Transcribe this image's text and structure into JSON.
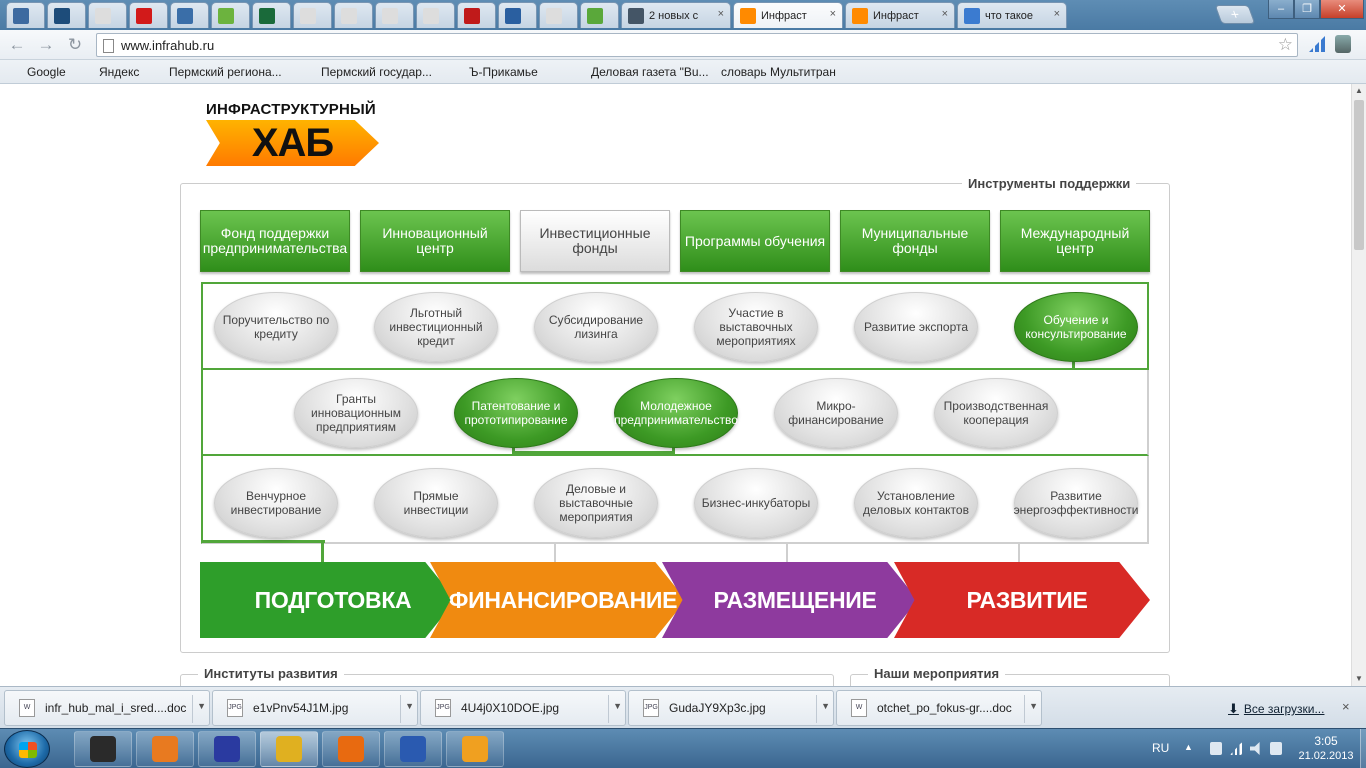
{
  "browser": {
    "tabs": [
      {
        "title": "",
        "color": "#3d6aa0"
      },
      {
        "title": "",
        "color": "#1d4c7a"
      },
      {
        "title": "",
        "color": "#dddddd"
      },
      {
        "title": "",
        "color": "#d21a1a"
      },
      {
        "title": "",
        "color": "#3a6ea8"
      },
      {
        "title": "",
        "color": "#6cb33e"
      },
      {
        "title": "",
        "color": "#1a6a3a"
      },
      {
        "title": "",
        "color": "#dddddd"
      },
      {
        "title": "",
        "color": "#dddddd"
      },
      {
        "title": "",
        "color": "#dddddd"
      },
      {
        "title": "",
        "color": "#dddddd"
      },
      {
        "title": "",
        "color": "#c01a1a"
      },
      {
        "title": "",
        "color": "#2a5fa0"
      },
      {
        "title": "",
        "color": "#dddddd"
      },
      {
        "title": "",
        "color": "#5aa83a"
      },
      {
        "title": "2 новых с",
        "color": "#445566"
      },
      {
        "title": "Инфраст",
        "color": "#ff8a00",
        "active": true
      },
      {
        "title": "Инфраст",
        "color": "#ff8a00"
      },
      {
        "title": "что такое",
        "color": "#3b7bd0"
      }
    ],
    "close_glyph": "×",
    "new_tab_glyph": "+",
    "window_buttons": {
      "minimize": "–",
      "maximize": "❐",
      "close": "✕"
    },
    "nav": {
      "back": "←",
      "forward": "→",
      "reload": "↻"
    },
    "url": "www.infrahub.ru",
    "star_glyph": "☆",
    "bookmarks": [
      {
        "label": "Google",
        "color": "#4a7ad0"
      },
      {
        "label": "Яндекс",
        "color": "#e02020"
      },
      {
        "label": "Пермский региона...",
        "color": "#ffffff"
      },
      {
        "label": "Пермский государ...",
        "color": "#ffffff"
      },
      {
        "label": "Ъ-Прикамье",
        "color": "#3a8ad0"
      },
      {
        "label": "Деловая газета \"Bu...",
        "color": "#d02030"
      },
      {
        "label": "словарь Мультитран",
        "color": "#2a6ad0"
      }
    ]
  },
  "site": {
    "logo_top": "ИНФРАСТРУКТУРНЫЙ",
    "logo_main": "ХАБ",
    "support_legend": "Инструменты поддержки",
    "categories": [
      {
        "label": "Фонд поддержки предпринимательства",
        "green": true
      },
      {
        "label": "Инновационный центр",
        "green": true
      },
      {
        "label": "Инвестиционные фонды",
        "green": false
      },
      {
        "label": "Программы обучения",
        "green": true
      },
      {
        "label": "Муниципальные фонды",
        "green": true
      },
      {
        "label": "Международный центр",
        "green": true
      }
    ],
    "row1": [
      {
        "label": "Поручительство по кредиту",
        "green": false
      },
      {
        "label": "Льготный инвестиционный кредит",
        "green": false
      },
      {
        "label": "Субсидирование лизинга",
        "green": false
      },
      {
        "label": "Участие в выставочных мероприятиях",
        "green": false
      },
      {
        "label": "Развитие экспорта",
        "green": false
      },
      {
        "label": "Обучение и консультирование",
        "green": true
      }
    ],
    "row2": [
      {
        "label": "Гранты инновационным предприятиям",
        "green": false
      },
      {
        "label": "Патентование и прототипирование",
        "green": true
      },
      {
        "label": "Молодежное предпринимательство",
        "green": true
      },
      {
        "label": "Микро-финансирование",
        "green": false
      },
      {
        "label": "Производственная кооперация",
        "green": false
      }
    ],
    "row3": [
      {
        "label": "Венчурное инвестирование",
        "green": false
      },
      {
        "label": "Прямые инвестиции",
        "green": false
      },
      {
        "label": "Деловые и выставочные мероприятия",
        "green": false
      },
      {
        "label": "Бизнес-инкубаторы",
        "green": false
      },
      {
        "label": "Установление деловых контактов",
        "green": false
      },
      {
        "label": "Развитие энергоэффективности",
        "green": false
      }
    ],
    "stages": [
      {
        "label": "ПОДГОТОВКА",
        "color": "#2e9e2a"
      },
      {
        "label": "ФИНАНСИРОВАНИЕ",
        "color": "#f08a10"
      },
      {
        "label": "РАЗМЕЩЕНИЕ",
        "color": "#8e3a9e"
      },
      {
        "label": "РАЗВИТИЕ",
        "color": "#d82a26"
      }
    ],
    "institutes_legend": "Институты развития",
    "events_legend": "Наши мероприятия"
  },
  "downloads": {
    "items": [
      {
        "name": "infr_hub_mal_i_sred....doc",
        "type": "W"
      },
      {
        "name": "e1vPnv54J1M.jpg",
        "type": "JPG"
      },
      {
        "name": "4U4j0X10DOE.jpg",
        "type": "JPG"
      },
      {
        "name": "GudaJY9Xp3c.jpg",
        "type": "JPG"
      },
      {
        "name": "otchet_po_fokus-gr....doc",
        "type": "W"
      }
    ],
    "all_label": "Все загрузки...",
    "close_glyph": "×",
    "menu_glyph": "▼"
  },
  "taskbar": {
    "apps": [
      {
        "name": "explorer",
        "color": "#2a2a2a"
      },
      {
        "name": "media-player",
        "color": "#e87a20"
      },
      {
        "name": "save",
        "color": "#2a3aa0"
      },
      {
        "name": "chrome",
        "color": "#e0b020",
        "active": true
      },
      {
        "name": "outlook",
        "color": "#e86a10"
      },
      {
        "name": "word",
        "color": "#2a5ab0"
      },
      {
        "name": "aimp",
        "color": "#f0a020"
      }
    ],
    "lang": "RU",
    "time": "3:05",
    "date": "21.02.2013"
  }
}
